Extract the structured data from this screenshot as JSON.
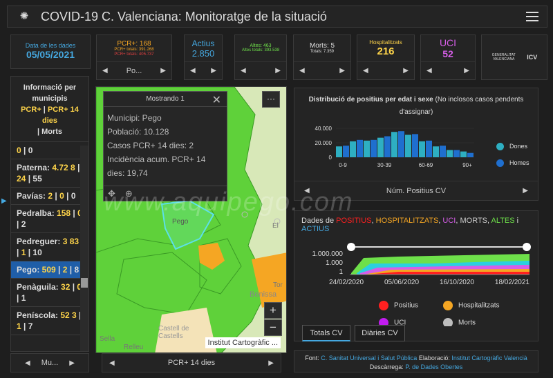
{
  "header": {
    "title": "COVID-19 C. Valenciana: Monitoratge de la situació",
    "logo_icon": "virus-logo-icon",
    "menu_icon": "hamburger-menu-icon"
  },
  "cards": {
    "date": {
      "label": "Data de les dades",
      "value": "05/05/2021"
    },
    "pcr": {
      "label": "PCR+: 168",
      "line2": "PCR+ totals: 391.268",
      "line3": "PCR+ totals: 405.737",
      "pager": "Po..."
    },
    "actius": {
      "label": "Actius",
      "value": "2.850"
    },
    "altes": {
      "label": "Altes: 463",
      "line2": "Altes totals: 393.538"
    },
    "morts": {
      "label": "Morts: 5",
      "line2": "Totals: 7.359"
    },
    "hosp": {
      "label": "Hospitalitzats",
      "value": "216"
    },
    "uci": {
      "label": "UCI",
      "value": "52"
    },
    "logos": {
      "l1": "GENERALITAT VALENCIANA",
      "l2": "ICV"
    }
  },
  "colors": {
    "pcr": "#f5a623",
    "actius": "#45a8e0",
    "altes": "#6ee04a",
    "hosp": "#ffd54a",
    "uci": "#d65ee8",
    "dones": "#2eafc2",
    "homes": "#1f6fcf",
    "selected": "#1f5ea8"
  },
  "municipis": {
    "heading": "Informació per municipis",
    "legend_a": "PCR+",
    "sep": " | ",
    "legend_b": "PCR+ 14 dies",
    "legend_c": "Morts",
    "items": [
      {
        "name": "",
        "a": "0",
        "b": "",
        "c": "0"
      },
      {
        "name": "Paterna: ",
        "a": "4.72 8",
        "b": "24",
        "c": "55"
      },
      {
        "name": "Pavías: ",
        "a": "2",
        "b": "0",
        "c": "0"
      },
      {
        "name": "Pedralba: ",
        "a": "158",
        "b": "0",
        "c": "2"
      },
      {
        "name": "Pedreguer: ",
        "a": "3 83",
        "b": "1",
        "c": "10"
      },
      {
        "name": "Pego: ",
        "a": "509",
        "b": "2",
        "c": "8"
      },
      {
        "name": "Penàguila: ",
        "a": "32",
        "b": "0",
        "c": "1"
      },
      {
        "name": "Peníscola: ",
        "a": "52 3",
        "b": "1",
        "c": "7"
      }
    ],
    "pager": "Mu..."
  },
  "map": {
    "popup_title": "Mostrando 1",
    "popup_lines": [
      "Municipi: Pego",
      "Població: 10.128",
      "Casos PCR+ 14 dies: 2",
      "Incidència acum. PCR+ 14 dies: 19,74"
    ],
    "labels": {
      "pego": "Pego",
      "benissa": "Benissa",
      "castell": "Castell de Castells",
      "relleu": "Relleu",
      "sella": "Sella",
      "tor": "Tor",
      "el": "El"
    },
    "attribution": "Institut Cartogràfic ...",
    "footer": "PCR+ 14 dies",
    "zoom_in": "+",
    "zoom_out": "−",
    "more": "···"
  },
  "age_chart": {
    "title_main": "Distribució de positius per edat i sexe",
    "title_rest": " (No inclosos casos pendents d'assignar)",
    "footer": "Núm. Positius CV"
  },
  "chart_data": [
    {
      "type": "bar",
      "title": "Distribució de positius per edat i sexe",
      "categories": [
        "0-9",
        "",
        "",
        "30-39",
        "",
        "",
        "60-69",
        "",
        "",
        "90+"
      ],
      "yticks": [
        "40.000",
        "20.000",
        "0"
      ],
      "ylim": [
        0,
        40000
      ],
      "legend": [
        "Dones",
        "Homes"
      ],
      "series": [
        {
          "name": "Dones",
          "values": [
            15000,
            22000,
            23000,
            27000,
            35000,
            31000,
            22000,
            15000,
            10000,
            8000
          ]
        },
        {
          "name": "Homes",
          "values": [
            16000,
            24000,
            24000,
            29000,
            36000,
            32000,
            23000,
            16000,
            10000,
            6000
          ]
        }
      ]
    },
    {
      "type": "area",
      "title": "Dades de POSITIUS, HOSPITALITZATS, UCI, MORTS, ALTES i ACTIUS",
      "x_ticks": [
        "24/02/2020",
        "05/06/2020",
        "16/10/2020",
        "18/02/2021"
      ],
      "y_ticks": [
        "1.000.000",
        "1.000",
        "1"
      ],
      "scale": "log",
      "legend": [
        {
          "name": "Positius",
          "color": "#ff2020"
        },
        {
          "name": "Hospitalitzats",
          "color": "#f5a623"
        },
        {
          "name": "UCI",
          "color": "#c21cf0"
        },
        {
          "name": "Morts",
          "color": "#bdbdbd"
        }
      ]
    }
  ],
  "timeline": {
    "t_dades": "Dades de ",
    "t_pos": "POSITIUS",
    "t_hosp": "HOSPITALITZATS",
    "t_uci": "UCI",
    "t_morts": "MORTS",
    "t_altes": "ALTES",
    "t_i": " i ",
    "t_act": "ACTIUS",
    "comma": ", ",
    "tab1": "Totals CV",
    "tab2": "Diàries CV"
  },
  "footer": {
    "font_label": "Font: ",
    "font_val": "C. Sanitat Universal i Salut Pública",
    "elab_label": " Elaboració: ",
    "elab_val": "Institut Cartogràfic Valencià",
    "desc_label": " Descàrrega: ",
    "desc_val": "P. de Dades Obertes"
  },
  "watermark": "www.aquipego.com"
}
